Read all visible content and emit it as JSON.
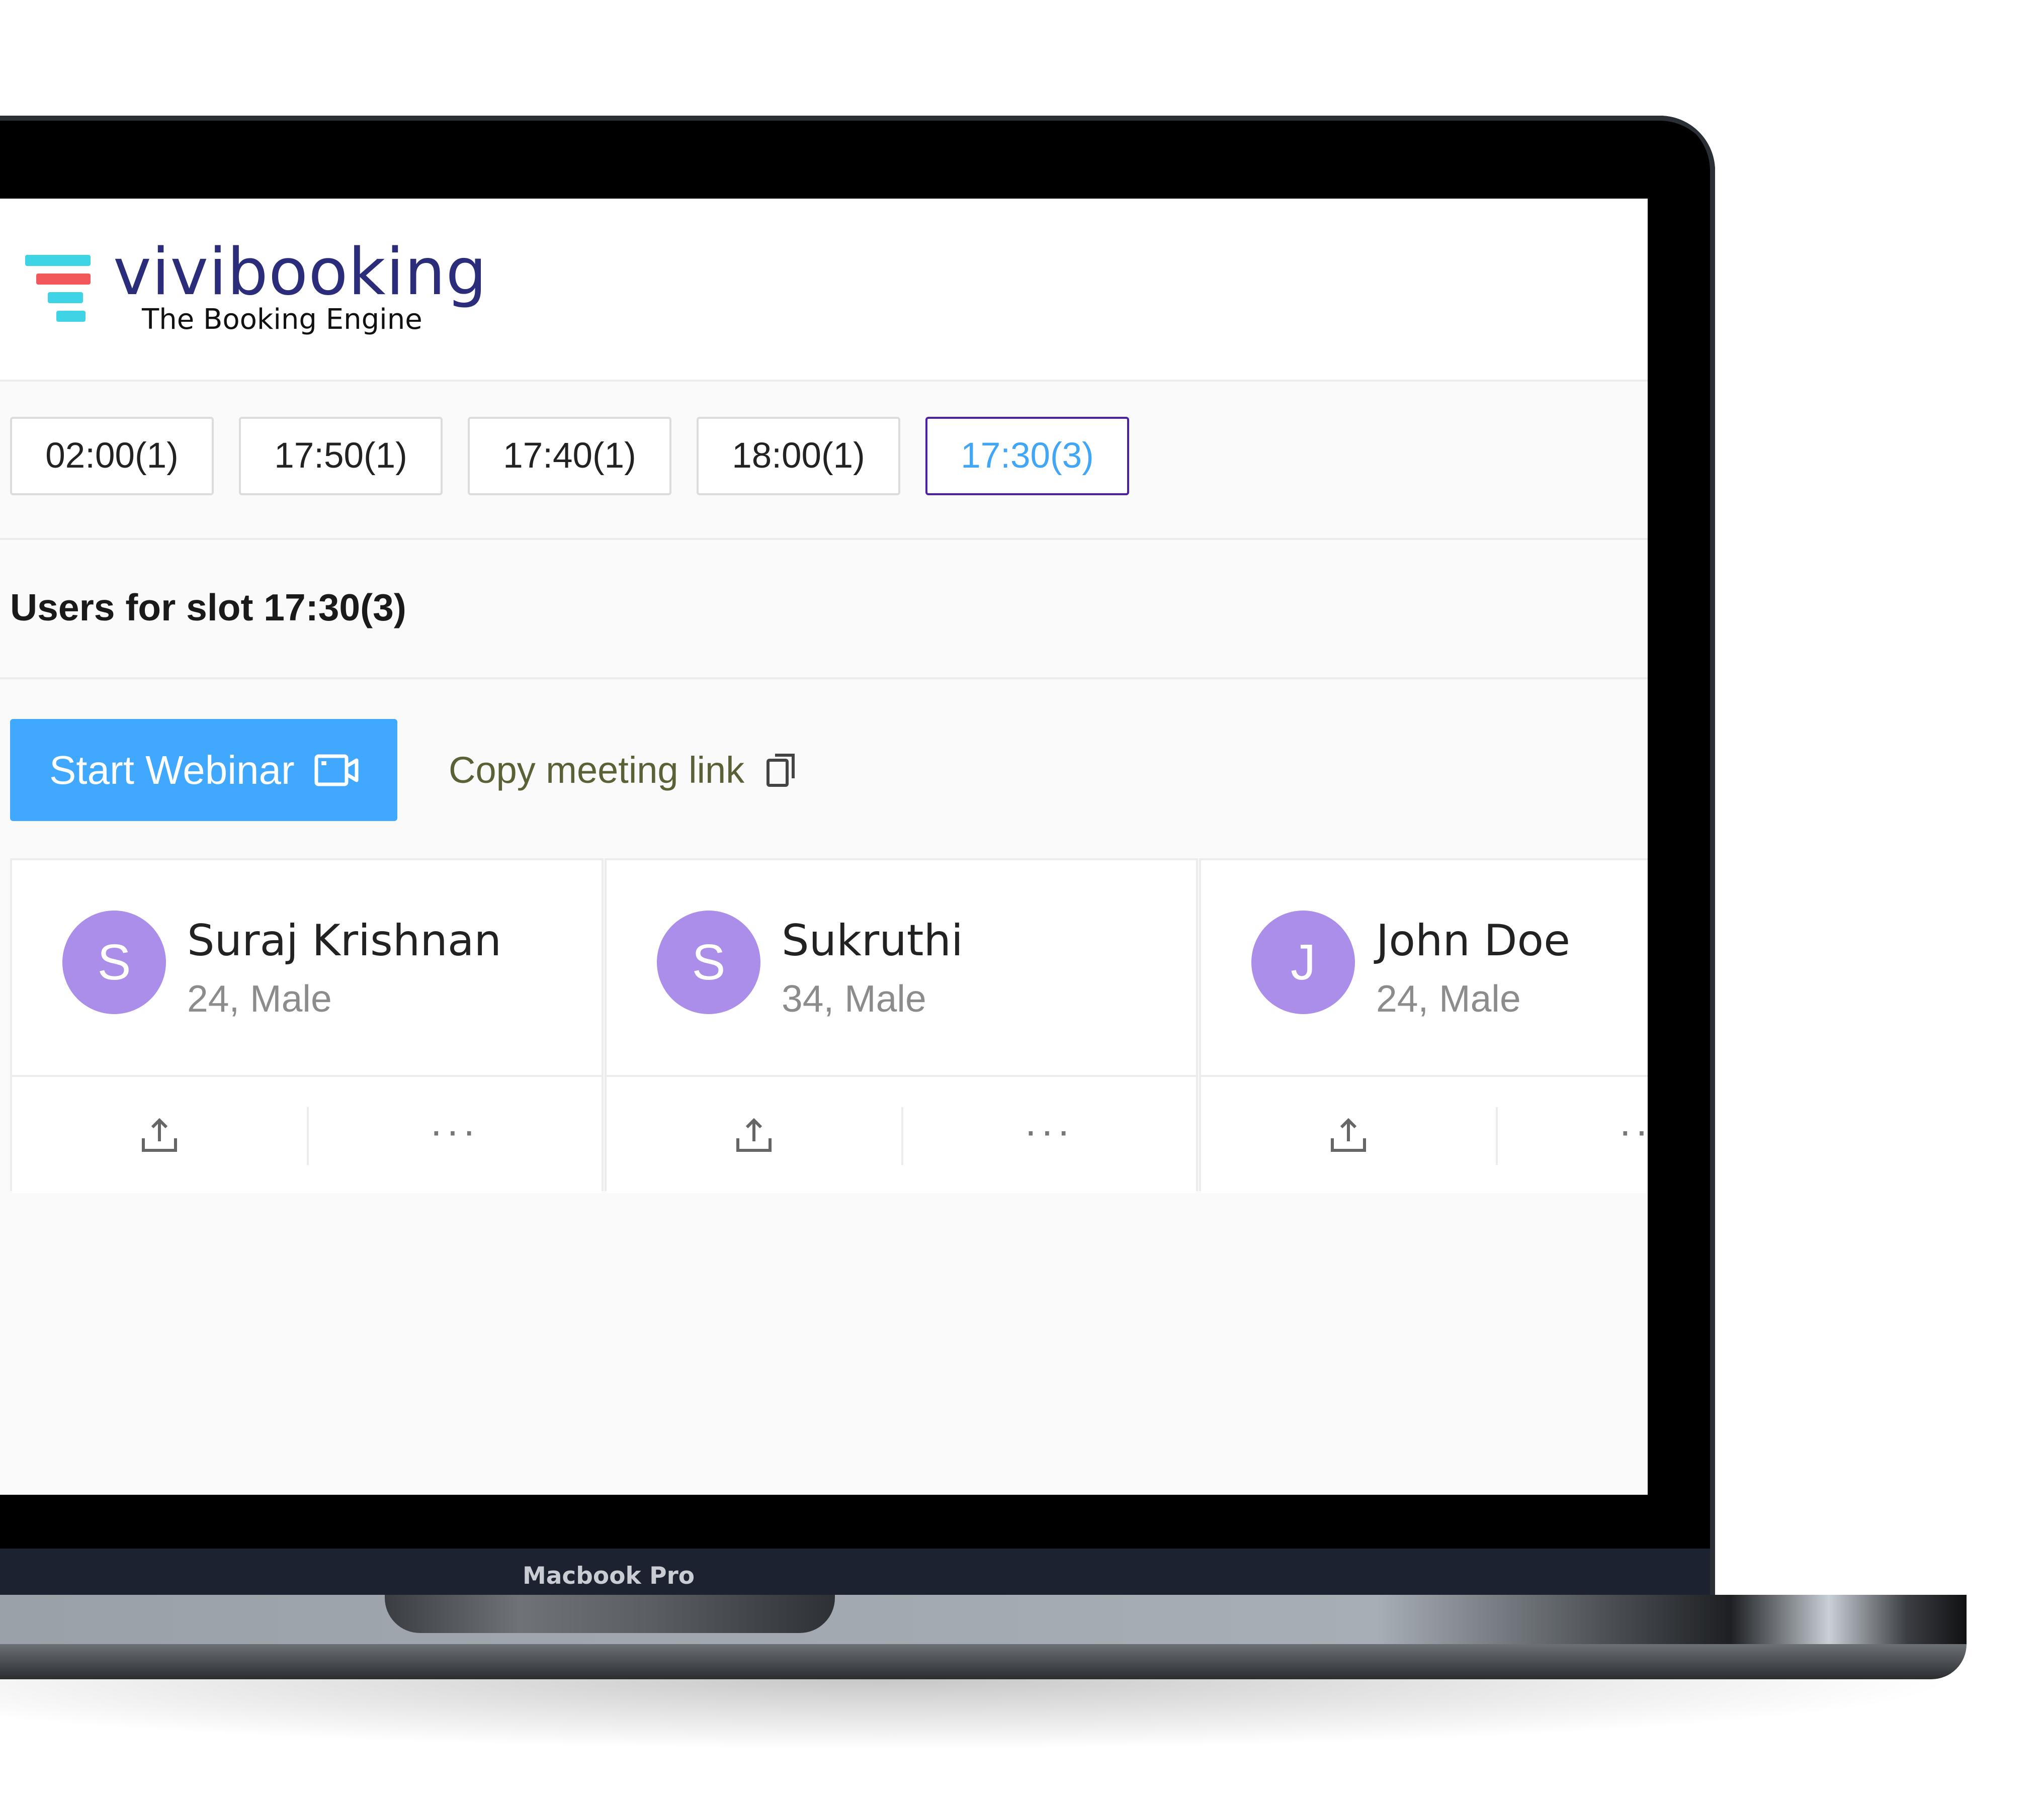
{
  "brand": {
    "name": "vivibooking",
    "tagline": "The Booking Engine",
    "colors": {
      "name": "#2b2d7a",
      "mark_red": "#f2575a",
      "mark_cyan": "#3fd3e6"
    }
  },
  "slots": [
    {
      "label": "02:00(1)",
      "selected": false
    },
    {
      "label": "17:50(1)",
      "selected": false
    },
    {
      "label": "17:40(1)",
      "selected": false
    },
    {
      "label": "18:00(1)",
      "selected": false
    },
    {
      "label": "17:30(3)",
      "selected": true
    }
  ],
  "section": {
    "title": "Users for slot 17:30(3)"
  },
  "actions": {
    "start_webinar": "Start Webinar",
    "start_webinar_icon": "video-camera-icon",
    "copy_link": "Copy meeting link",
    "copy_link_icon": "copy-icon"
  },
  "users": [
    {
      "initial": "S",
      "name": "Suraj Krishnan",
      "meta": "24, Male"
    },
    {
      "initial": "S",
      "name": "Sukruthi",
      "meta": "34, Male"
    },
    {
      "initial": "J",
      "name": "John Doe",
      "meta": "24, Male"
    }
  ],
  "card_action_icons": [
    "upload-icon",
    "more-options-icon"
  ],
  "device": {
    "label": "Macbook Pro"
  },
  "colors": {
    "accent": "#40a9ff",
    "selected_border": "#4b1fa7",
    "selected_text": "#40a6f5",
    "avatar": "#ab8ee9"
  }
}
